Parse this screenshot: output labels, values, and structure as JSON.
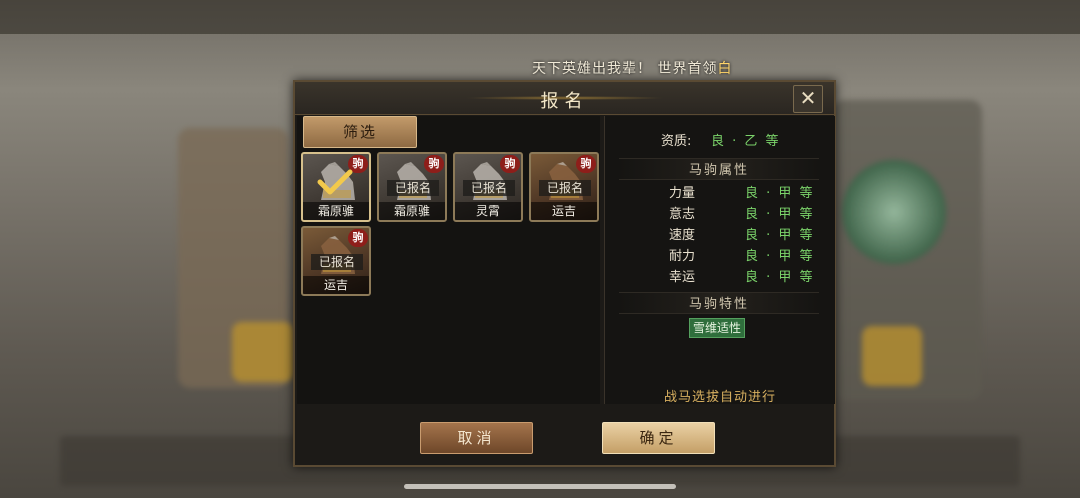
{
  "banner": {
    "text": "天下英雄出我辈！ 世界首领",
    "highlight": "白"
  },
  "dialog": {
    "title": "报名",
    "filter_label": "筛选",
    "cancel_label": "取消",
    "confirm_label": "确定"
  },
  "horses": [
    {
      "name": "霜原骓",
      "signed": "",
      "badge": "驹",
      "selected": true
    },
    {
      "name": "霜原骓",
      "signed": "已报名",
      "badge": "驹",
      "selected": false
    },
    {
      "name": "灵霄",
      "signed": "已报名",
      "badge": "驹",
      "selected": false
    },
    {
      "name": "运吉",
      "signed": "已报名",
      "badge": "驹",
      "selected": false
    },
    {
      "name": "运吉",
      "signed": "已报名",
      "badge": "驹",
      "selected": false
    }
  ],
  "detail": {
    "aptitude_label": "资质:",
    "aptitude_value": "良 · 乙 等",
    "attr_header": "马驹属性",
    "attributes": [
      {
        "label": "力量",
        "value": "良 · 甲 等"
      },
      {
        "label": "意志",
        "value": "良 · 甲 等"
      },
      {
        "label": "速度",
        "value": "良 · 甲 等"
      },
      {
        "label": "耐力",
        "value": "良 · 甲 等"
      },
      {
        "label": "幸运",
        "value": "良 · 甲 等"
      }
    ],
    "trait_header": "马驹特性",
    "trait": "雪维适性",
    "auto_note": "战马选拔自动进行"
  },
  "colors": {
    "accent_green": "#7bd36a",
    "badge_red": "#8e1e1a",
    "gold": "#d8b060"
  }
}
